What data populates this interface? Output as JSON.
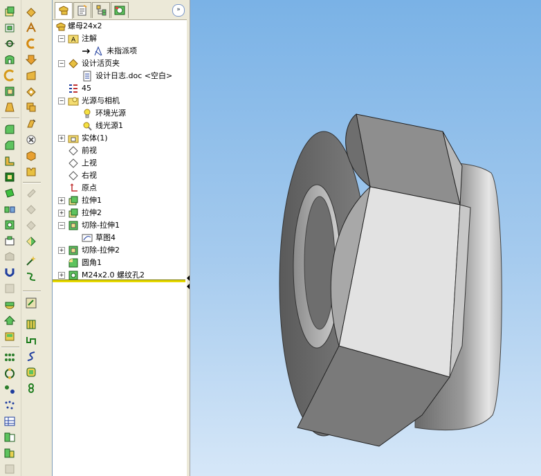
{
  "feature_tabs": [
    {
      "name": "featuremanager-icon",
      "active": true
    },
    {
      "name": "propertymanager-icon",
      "active": false
    },
    {
      "name": "configurationmanager-icon",
      "active": false
    },
    {
      "name": "dimxpert-icon",
      "active": false
    }
  ],
  "expand_button": "»",
  "tree": {
    "root": "螺母24x2",
    "annotations": "注解",
    "unassigned_items": "未指派项",
    "design_binder": "设计活页夹",
    "design_log": "设计日志.doc <空白>",
    "material": "45",
    "lights_cameras": "光源与相机",
    "ambient": "环境光源",
    "directional": "线光源1",
    "solid_bodies": "实体(1)",
    "front_plane": "前视",
    "top_plane": "上视",
    "right_plane": "右视",
    "origin": "原点",
    "extrude1": "拉伸1",
    "extrude2": "拉伸2",
    "cut_extrude1": "切除-拉伸1",
    "sketch4": "草图4",
    "cut_extrude2": "切除-拉伸2",
    "fillet1": "圆角1",
    "hole": "M24x2.0 螺纹孔2"
  },
  "colors": {
    "viewport_top": "#7ab2e6",
    "viewport_bottom": "#d6e7f8",
    "rollback_bar": "#e6d800",
    "panel_bg": "#ffffff",
    "toolbar_bg": "#ece9d8"
  }
}
